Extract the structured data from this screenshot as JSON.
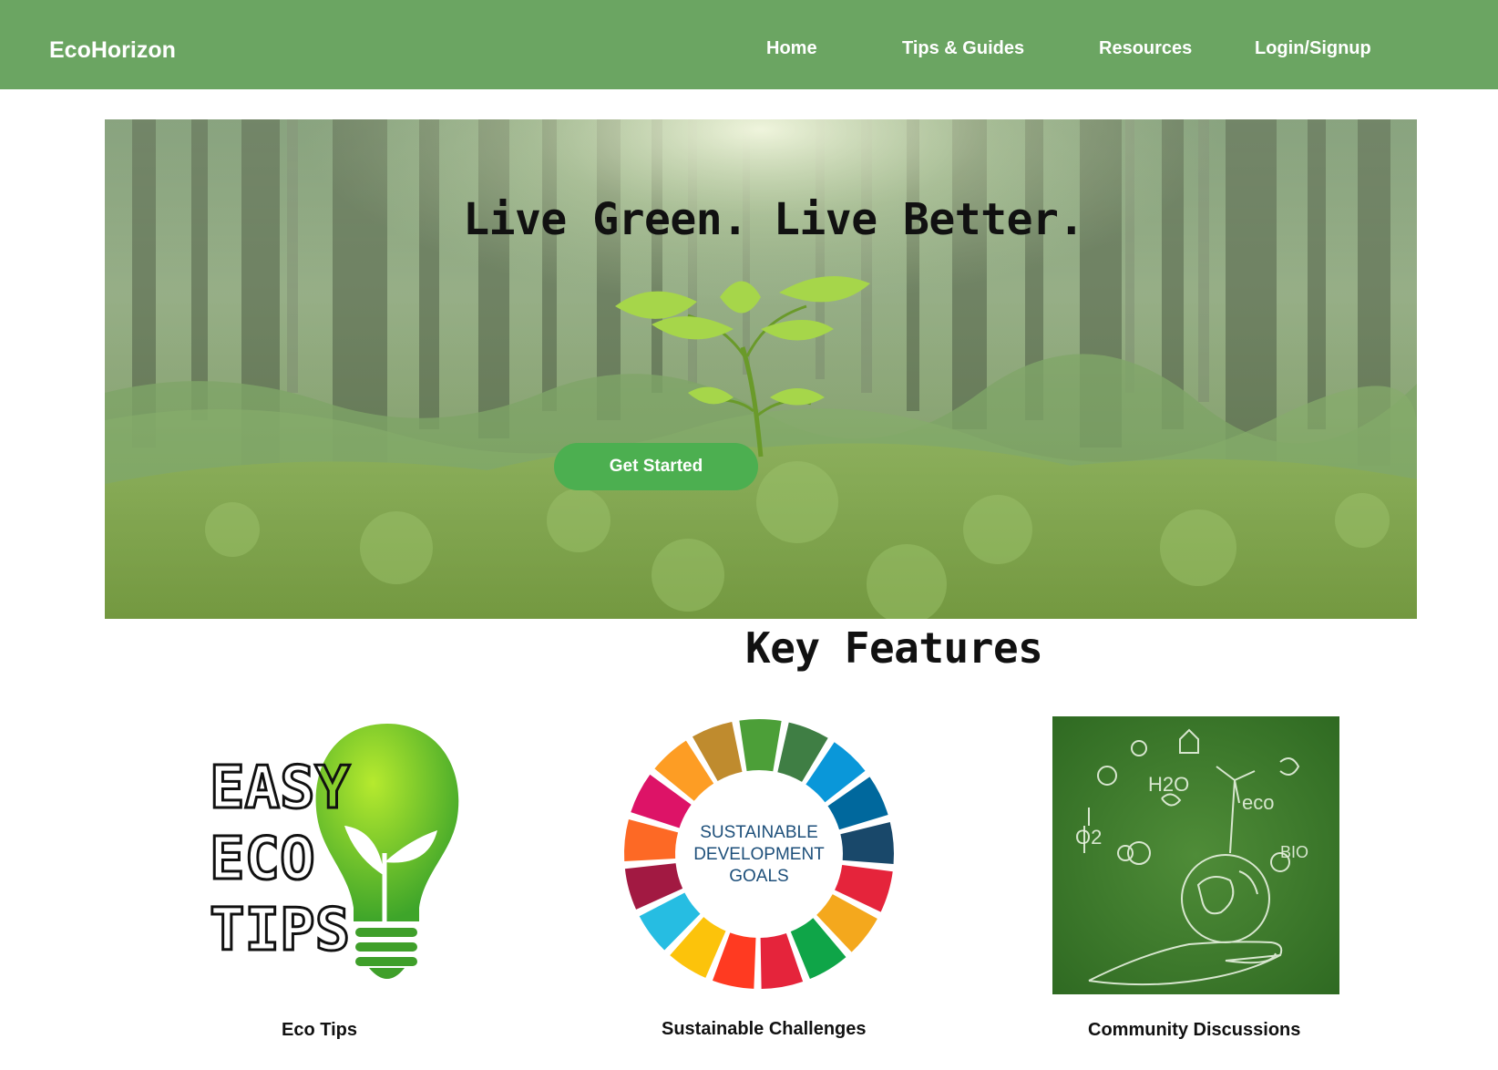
{
  "header": {
    "brand": "EcoHorizon",
    "nav": {
      "home": "Home",
      "tips": "Tips & Guides",
      "resources": "Resources",
      "login": "Login/Signup"
    }
  },
  "hero": {
    "title": "Live Green. Live Better.",
    "cta_label": "Get Started"
  },
  "features": {
    "title": "Key Features",
    "eco_tips": {
      "label": "Eco Tips",
      "logo_text": [
        "EASY",
        "ECO",
        "TIPS"
      ]
    },
    "challenges": {
      "label": "Sustainable Challenges",
      "logo_text": [
        "SUSTAINABLE",
        "DEVELOPMENT",
        "GOALS"
      ]
    },
    "community": {
      "label": "Community Discussions",
      "sketch_text": [
        "H2O",
        "eco",
        "O2",
        "BIO"
      ]
    }
  },
  "colors": {
    "header_bg": "#6ba562",
    "cta_bg": "#4caf50",
    "bulb_green": "#5fbf2a"
  }
}
